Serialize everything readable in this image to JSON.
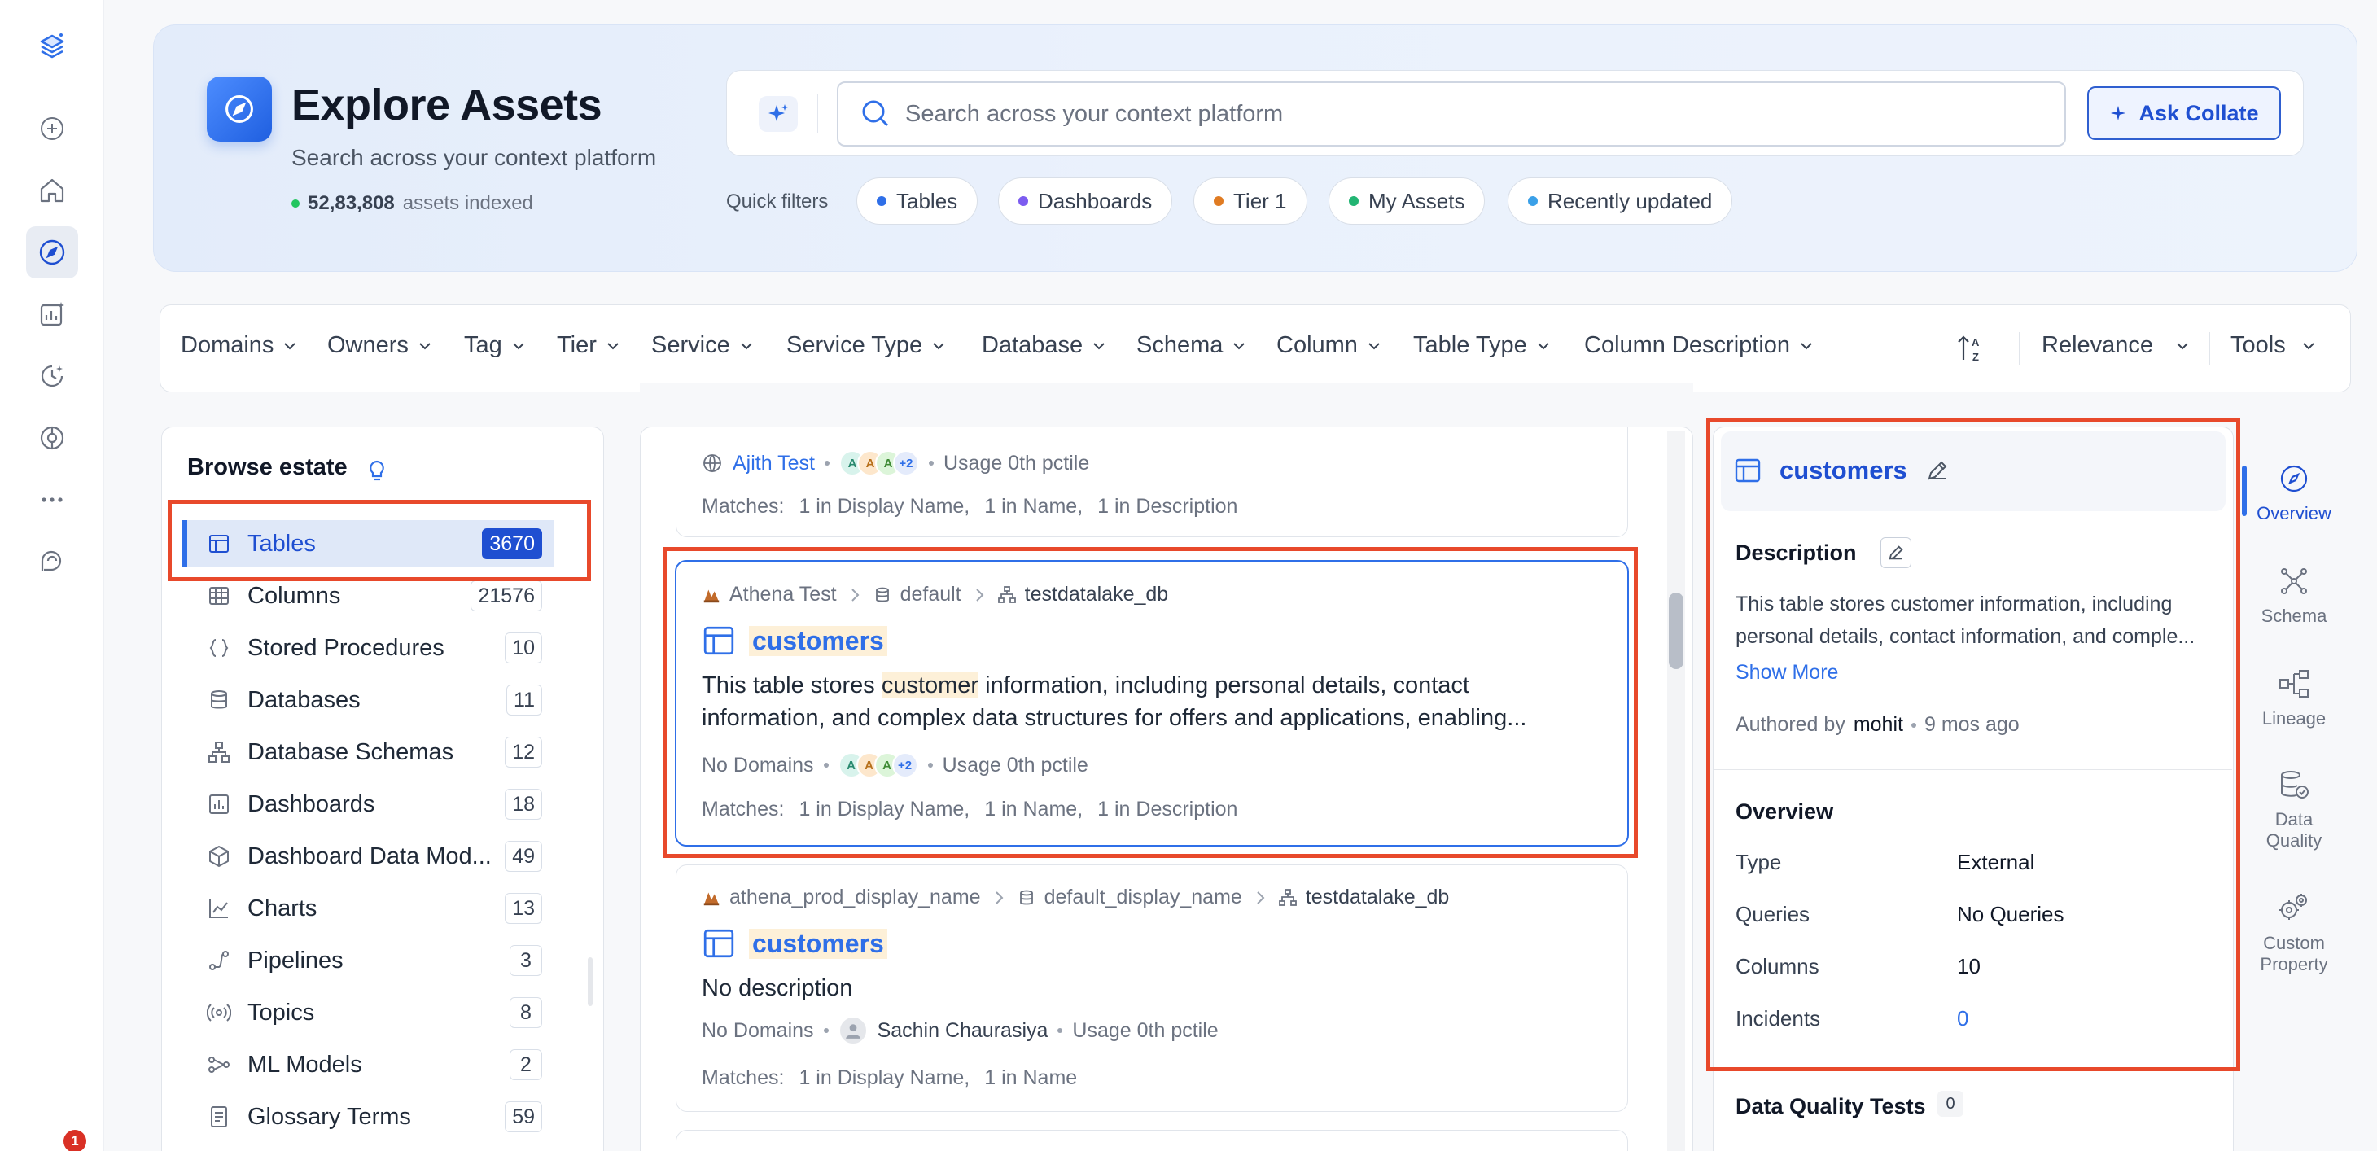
{
  "sidenav": {
    "items": [
      "logo-icon",
      "add-icon",
      "home-icon",
      "explore-icon",
      "insights-icon",
      "observability-icon",
      "governance-icon",
      "more-icon",
      "help-icon"
    ],
    "notification_count": "1"
  },
  "hero": {
    "title": "Explore Assets",
    "subtitle": "Search across your context platform",
    "assets_count": "52,83,808",
    "assets_label": "assets indexed"
  },
  "search": {
    "placeholder": "Search across your context platform",
    "ask_label": "Ask Collate"
  },
  "quick_filters": {
    "label": "Quick filters",
    "items": [
      {
        "label": "Tables",
        "color": "#2f6fe8"
      },
      {
        "label": "Dashboards",
        "color": "#7c5cf0"
      },
      {
        "label": "Tier 1",
        "color": "#e07b22"
      },
      {
        "label": "My Assets",
        "color": "#22b573"
      },
      {
        "label": "Recently updated",
        "color": "#3aa0e8"
      }
    ]
  },
  "filters": {
    "items": [
      "Domains",
      "Owners",
      "Tag",
      "Tier",
      "Service",
      "Service Type",
      "Database",
      "Schema",
      "Column",
      "Table Type",
      "Column Description"
    ],
    "sort_label": "Relevance",
    "tools_label": "Tools"
  },
  "browse": {
    "title": "Browse estate",
    "items": [
      {
        "label": "Tables",
        "count": "3670",
        "icon": "table-icon"
      },
      {
        "label": "Columns",
        "count": "21576",
        "icon": "columns-icon"
      },
      {
        "label": "Stored Procedures",
        "count": "10",
        "icon": "braces-icon"
      },
      {
        "label": "Databases",
        "count": "11",
        "icon": "database-icon"
      },
      {
        "label": "Database Schemas",
        "count": "12",
        "icon": "schema-icon"
      },
      {
        "label": "Dashboards",
        "count": "18",
        "icon": "dashboard-icon"
      },
      {
        "label": "Dashboard Data Mod...",
        "count": "49",
        "icon": "cube-icon"
      },
      {
        "label": "Charts",
        "count": "13",
        "icon": "chart-icon"
      },
      {
        "label": "Pipelines",
        "count": "3",
        "icon": "pipeline-icon"
      },
      {
        "label": "Topics",
        "count": "8",
        "icon": "topic-icon"
      },
      {
        "label": "ML Models",
        "count": "2",
        "icon": "ml-model-icon"
      },
      {
        "label": "Glossary Terms",
        "count": "59",
        "icon": "glossary-icon"
      }
    ]
  },
  "results": {
    "card0": {
      "owner": "Ajith Test",
      "avatars": [
        "A",
        "A",
        "A"
      ],
      "more": "+2",
      "usage": "Usage 0th pctile",
      "matches_label": "Matches:",
      "matches": [
        "1 in Display Name,",
        "1 in Name,",
        "1 in Description"
      ]
    },
    "card1": {
      "service": "Athena Test",
      "database": "default",
      "schema": "testdatalake_db",
      "title": "customers",
      "desc_pre": "This table stores ",
      "desc_hl": "customer",
      "desc_post": " information, including personal details, contact",
      "desc_line2": "information, and complex data structures for offers and applications, enabling...",
      "domains": "No Domains",
      "avatars": [
        "A",
        "A",
        "A"
      ],
      "more": "+2",
      "usage": "Usage 0th pctile",
      "matches_label": "Matches:",
      "matches": [
        "1 in Display Name,",
        "1 in Name,",
        "1 in Description"
      ]
    },
    "card2": {
      "service": "athena_prod_display_name",
      "database": "default_display_name",
      "schema": "testdatalake_db",
      "title": "customers",
      "desc": "No description",
      "domains": "No Domains",
      "owner": "Sachin Chaurasiya",
      "usage": "Usage 0th pctile",
      "matches_label": "Matches:",
      "matches": [
        "1 in Display Name,",
        "1 in Name"
      ]
    }
  },
  "detail": {
    "title": "customers",
    "description_label": "Description",
    "description_line1": "This table stores customer information, including",
    "description_line2": "personal details, contact information, and comple...",
    "show_more": "Show More",
    "authored_by": "Authored by",
    "author": "mohit",
    "time_ago": "9 mos ago",
    "overview_label": "Overview",
    "overview": [
      {
        "key": "Type",
        "value": "External"
      },
      {
        "key": "Queries",
        "value": "No Queries"
      },
      {
        "key": "Columns",
        "value": "10"
      },
      {
        "key": "Incidents",
        "value": "0"
      }
    ],
    "dq_label": "Data Quality Tests",
    "dq_count": "0"
  },
  "tabs": [
    {
      "label": "Overview",
      "icon": "compass-icon"
    },
    {
      "label": "Schema",
      "icon": "schema-graph-icon"
    },
    {
      "label": "Lineage",
      "icon": "lineage-icon"
    },
    {
      "label": "Data Quality",
      "icon": "data-quality-icon"
    },
    {
      "label": "Custom Property",
      "icon": "custom-property-icon"
    }
  ],
  "colors": {
    "accent": "#2f6fe8",
    "highlight_box": "#e8492b",
    "match_highlight": "#fdf0d8"
  }
}
